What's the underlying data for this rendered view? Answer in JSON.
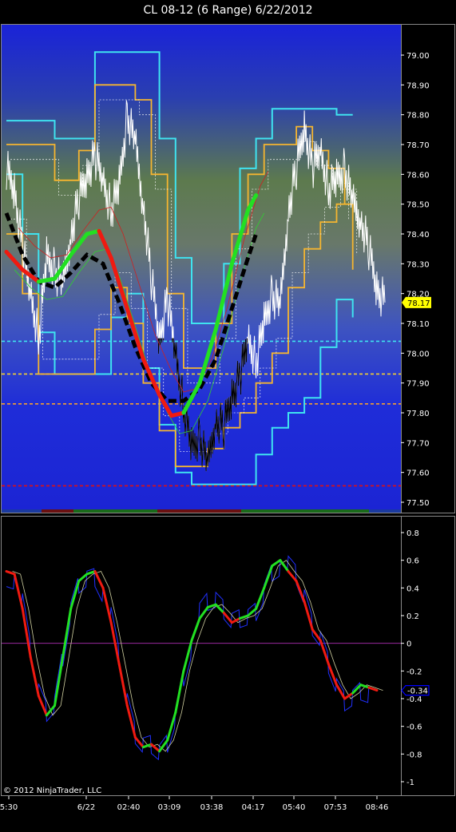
{
  "title": "CL 08-12 (6 Range)  6/22/2012",
  "copyright": "© 2012 NinjaTrader, LLC",
  "colors": {
    "background": "#000000",
    "price_gradient_top": "#1a2bd8",
    "price_gradient_mid": "#6b7a4a",
    "channel_outer": "#3fe3f0",
    "channel_inner": "#f5b530",
    "trend_up": "#22e022",
    "trend_down": "#f01a10",
    "midline_dash": "#000000",
    "zero_line": "#9a2aa0",
    "last_price_tag": "#ffff00",
    "osc_tag": "#0000ff"
  },
  "chart_data": [
    {
      "type": "line",
      "name_hint": "price panel",
      "y_ticks": [
        "79.00",
        "78.90",
        "78.80",
        "78.70",
        "78.60",
        "78.50",
        "78.40",
        "78.30",
        "78.20",
        "78.10",
        "78.00",
        "77.90",
        "77.80",
        "77.70",
        "77.60",
        "77.50"
      ],
      "ylim": [
        77.47,
        79.2
      ],
      "last_value_label": "78.17",
      "last_value": 78.17,
      "horizontal_lines": [
        {
          "value": 78.04,
          "color": "#3fe3f0",
          "style": "dashed"
        },
        {
          "value": 77.93,
          "color": "#f5d030",
          "style": "dashed"
        },
        {
          "value": 77.83,
          "color": "#f5a030",
          "style": "dashed"
        },
        {
          "value": 77.555,
          "color": "#e01010",
          "style": "dashed"
        }
      ],
      "price_path": [
        [
          0,
          78.62
        ],
        [
          2,
          78.55
        ],
        [
          4,
          78.35
        ],
        [
          6,
          78.2
        ],
        [
          8,
          78.05
        ],
        [
          10,
          78.32
        ],
        [
          12,
          78.28
        ],
        [
          14,
          78.22
        ],
        [
          16,
          78.4
        ],
        [
          18,
          78.52
        ],
        [
          20,
          78.6
        ],
        [
          22,
          78.66
        ],
        [
          24,
          78.58
        ],
        [
          26,
          78.48
        ],
        [
          28,
          78.56
        ],
        [
          30,
          78.8
        ],
        [
          32,
          78.7
        ],
        [
          34,
          78.5
        ],
        [
          36,
          78.25
        ],
        [
          38,
          78.05
        ],
        [
          40,
          78.18
        ],
        [
          42,
          78.0
        ],
        [
          44,
          77.82
        ],
        [
          46,
          77.68
        ],
        [
          48,
          77.72
        ],
        [
          50,
          77.62
        ],
        [
          52,
          77.78
        ],
        [
          54,
          77.75
        ],
        [
          56,
          77.86
        ],
        [
          58,
          77.92
        ],
        [
          60,
          78.05
        ],
        [
          62,
          77.97
        ],
        [
          64,
          78.1
        ],
        [
          66,
          78.2
        ],
        [
          68,
          78.15
        ],
        [
          70,
          78.48
        ],
        [
          72,
          78.62
        ],
        [
          74,
          78.76
        ],
        [
          76,
          78.62
        ],
        [
          78,
          78.68
        ],
        [
          80,
          78.55
        ],
        [
          82,
          78.58
        ],
        [
          84,
          78.62
        ],
        [
          86,
          78.5
        ],
        [
          88,
          78.45
        ],
        [
          90,
          78.35
        ],
        [
          92,
          78.22
        ],
        [
          94,
          78.17
        ]
      ],
      "trend_line": [
        [
          0,
          78.34
        ],
        [
          4,
          78.28
        ],
        [
          8,
          78.24
        ],
        [
          12,
          78.25
        ],
        [
          16,
          78.33
        ],
        [
          20,
          78.4
        ],
        [
          23,
          78.41
        ],
        [
          26,
          78.32
        ],
        [
          30,
          78.15
        ],
        [
          34,
          77.98
        ],
        [
          38,
          77.86
        ],
        [
          41,
          77.79
        ],
        [
          44,
          77.8
        ],
        [
          48,
          77.9
        ],
        [
          52,
          78.08
        ],
        [
          56,
          78.3
        ],
        [
          60,
          78.48
        ],
        [
          62,
          78.53
        ]
      ],
      "trend_colors": [
        "down",
        "down",
        "down",
        "up",
        "up",
        "up",
        "up",
        "down",
        "down",
        "down",
        "down",
        "down",
        "down",
        "up",
        "up",
        "up",
        "up",
        "up",
        "up"
      ],
      "midline": [
        [
          0,
          78.47
        ],
        [
          4,
          78.33
        ],
        [
          8,
          78.24
        ],
        [
          12,
          78.22
        ],
        [
          16,
          78.27
        ],
        [
          20,
          78.33
        ],
        [
          24,
          78.3
        ],
        [
          28,
          78.17
        ],
        [
          32,
          78.02
        ],
        [
          36,
          77.9
        ],
        [
          40,
          77.84
        ],
        [
          44,
          77.84
        ],
        [
          48,
          77.88
        ],
        [
          52,
          77.98
        ],
        [
          56,
          78.15
        ],
        [
          60,
          78.32
        ],
        [
          62,
          78.4
        ]
      ],
      "channel_outer_upper": [
        [
          0,
          78.78
        ],
        [
          6,
          78.78
        ],
        [
          12,
          78.72
        ],
        [
          18,
          78.72
        ],
        [
          22,
          79.01
        ],
        [
          28,
          79.01
        ],
        [
          34,
          79.01
        ],
        [
          38,
          78.72
        ],
        [
          42,
          78.32
        ],
        [
          46,
          78.1
        ],
        [
          50,
          78.1
        ],
        [
          54,
          78.3
        ],
        [
          58,
          78.62
        ],
        [
          62,
          78.72
        ],
        [
          66,
          78.82
        ],
        [
          70,
          78.82
        ],
        [
          74,
          78.82
        ],
        [
          78,
          78.82
        ],
        [
          82,
          78.8
        ],
        [
          86,
          78.8
        ]
      ],
      "channel_outer_lower": [
        [
          0,
          78.6
        ],
        [
          4,
          78.4
        ],
        [
          8,
          78.07
        ],
        [
          12,
          77.93
        ],
        [
          18,
          77.93
        ],
        [
          22,
          77.93
        ],
        [
          26,
          78.12
        ],
        [
          30,
          78.2
        ],
        [
          34,
          77.95
        ],
        [
          38,
          77.76
        ],
        [
          42,
          77.6
        ],
        [
          46,
          77.56
        ],
        [
          50,
          77.56
        ],
        [
          54,
          77.56
        ],
        [
          58,
          77.56
        ],
        [
          62,
          77.66
        ],
        [
          66,
          77.75
        ],
        [
          70,
          77.8
        ],
        [
          74,
          77.85
        ],
        [
          78,
          78.02
        ],
        [
          82,
          78.18
        ],
        [
          86,
          78.12
        ]
      ],
      "channel_inner_upper": [
        [
          0,
          78.7
        ],
        [
          6,
          78.7
        ],
        [
          12,
          78.58
        ],
        [
          18,
          78.68
        ],
        [
          22,
          78.9
        ],
        [
          28,
          78.9
        ],
        [
          32,
          78.85
        ],
        [
          36,
          78.6
        ],
        [
          40,
          78.2
        ],
        [
          44,
          77.95
        ],
        [
          48,
          77.95
        ],
        [
          52,
          78.1
        ],
        [
          56,
          78.4
        ],
        [
          60,
          78.6
        ],
        [
          64,
          78.7
        ],
        [
          68,
          78.7
        ],
        [
          72,
          78.76
        ],
        [
          76,
          78.68
        ],
        [
          80,
          78.62
        ],
        [
          84,
          78.5
        ]
      ],
      "channel_inner_lower": [
        [
          0,
          78.4
        ],
        [
          4,
          78.2
        ],
        [
          8,
          77.93
        ],
        [
          12,
          77.93
        ],
        [
          18,
          77.93
        ],
        [
          22,
          78.08
        ],
        [
          26,
          78.22
        ],
        [
          30,
          78.1
        ],
        [
          34,
          77.9
        ],
        [
          38,
          77.74
        ],
        [
          42,
          77.62
        ],
        [
          46,
          77.62
        ],
        [
          50,
          77.68
        ],
        [
          54,
          77.75
        ],
        [
          58,
          77.8
        ],
        [
          62,
          77.9
        ],
        [
          66,
          78.0
        ],
        [
          70,
          78.22
        ],
        [
          74,
          78.35
        ],
        [
          78,
          78.44
        ],
        [
          82,
          78.5
        ],
        [
          86,
          78.28
        ]
      ]
    },
    {
      "type": "line",
      "name_hint": "oscillator panel",
      "y_ticks": [
        "0.8",
        "0.6",
        "0.4",
        "0.2",
        "0",
        "-0.2",
        "-0.4",
        "-0.6",
        "-0.8",
        "-1"
      ],
      "ylim": [
        -1.08,
        0.86
      ],
      "last_value_label": "-0.34",
      "last_value": -0.34,
      "zero_line": 0,
      "x_ticks": [
        "5:30",
        "6/22",
        "02:40",
        "03:09",
        "03:38",
        "04:17",
        "05:40",
        "07:53",
        "08:46"
      ],
      "smooth_line": [
        [
          0,
          0.52
        ],
        [
          2,
          0.5
        ],
        [
          4,
          0.25
        ],
        [
          6,
          -0.1
        ],
        [
          8,
          -0.38
        ],
        [
          10,
          -0.52
        ],
        [
          12,
          -0.45
        ],
        [
          14,
          -0.1
        ],
        [
          16,
          0.25
        ],
        [
          18,
          0.45
        ],
        [
          20,
          0.5
        ],
        [
          22,
          0.52
        ],
        [
          24,
          0.4
        ],
        [
          26,
          0.15
        ],
        [
          28,
          -0.15
        ],
        [
          30,
          -0.45
        ],
        [
          32,
          -0.68
        ],
        [
          34,
          -0.75
        ],
        [
          36,
          -0.73
        ],
        [
          38,
          -0.78
        ],
        [
          40,
          -0.7
        ],
        [
          42,
          -0.5
        ],
        [
          44,
          -0.2
        ],
        [
          46,
          0.02
        ],
        [
          48,
          0.18
        ],
        [
          50,
          0.26
        ],
        [
          52,
          0.28
        ],
        [
          54,
          0.22
        ],
        [
          56,
          0.15
        ],
        [
          58,
          0.18
        ],
        [
          60,
          0.2
        ],
        [
          62,
          0.25
        ],
        [
          64,
          0.4
        ],
        [
          66,
          0.56
        ],
        [
          68,
          0.6
        ],
        [
          70,
          0.52
        ],
        [
          72,
          0.45
        ],
        [
          74,
          0.3
        ],
        [
          76,
          0.1
        ],
        [
          78,
          0.02
        ],
        [
          80,
          -0.15
        ],
        [
          82,
          -0.3
        ],
        [
          84,
          -0.4
        ],
        [
          86,
          -0.36
        ],
        [
          88,
          -0.3
        ],
        [
          90,
          -0.32
        ],
        [
          92,
          -0.34
        ]
      ],
      "smooth_colors": [
        "up",
        "down",
        "down",
        "down",
        "down",
        "down",
        "up",
        "up",
        "up",
        "up",
        "up",
        "up",
        "down",
        "down",
        "down",
        "down",
        "down",
        "down",
        "up",
        "down",
        "up",
        "up",
        "up",
        "up",
        "up",
        "up",
        "up",
        "up",
        "down",
        "down",
        "up",
        "up",
        "up",
        "up",
        "up",
        "up",
        "down",
        "down",
        "down",
        "down",
        "down",
        "down",
        "down",
        "down",
        "up",
        "up",
        "down",
        "down"
      ]
    }
  ]
}
